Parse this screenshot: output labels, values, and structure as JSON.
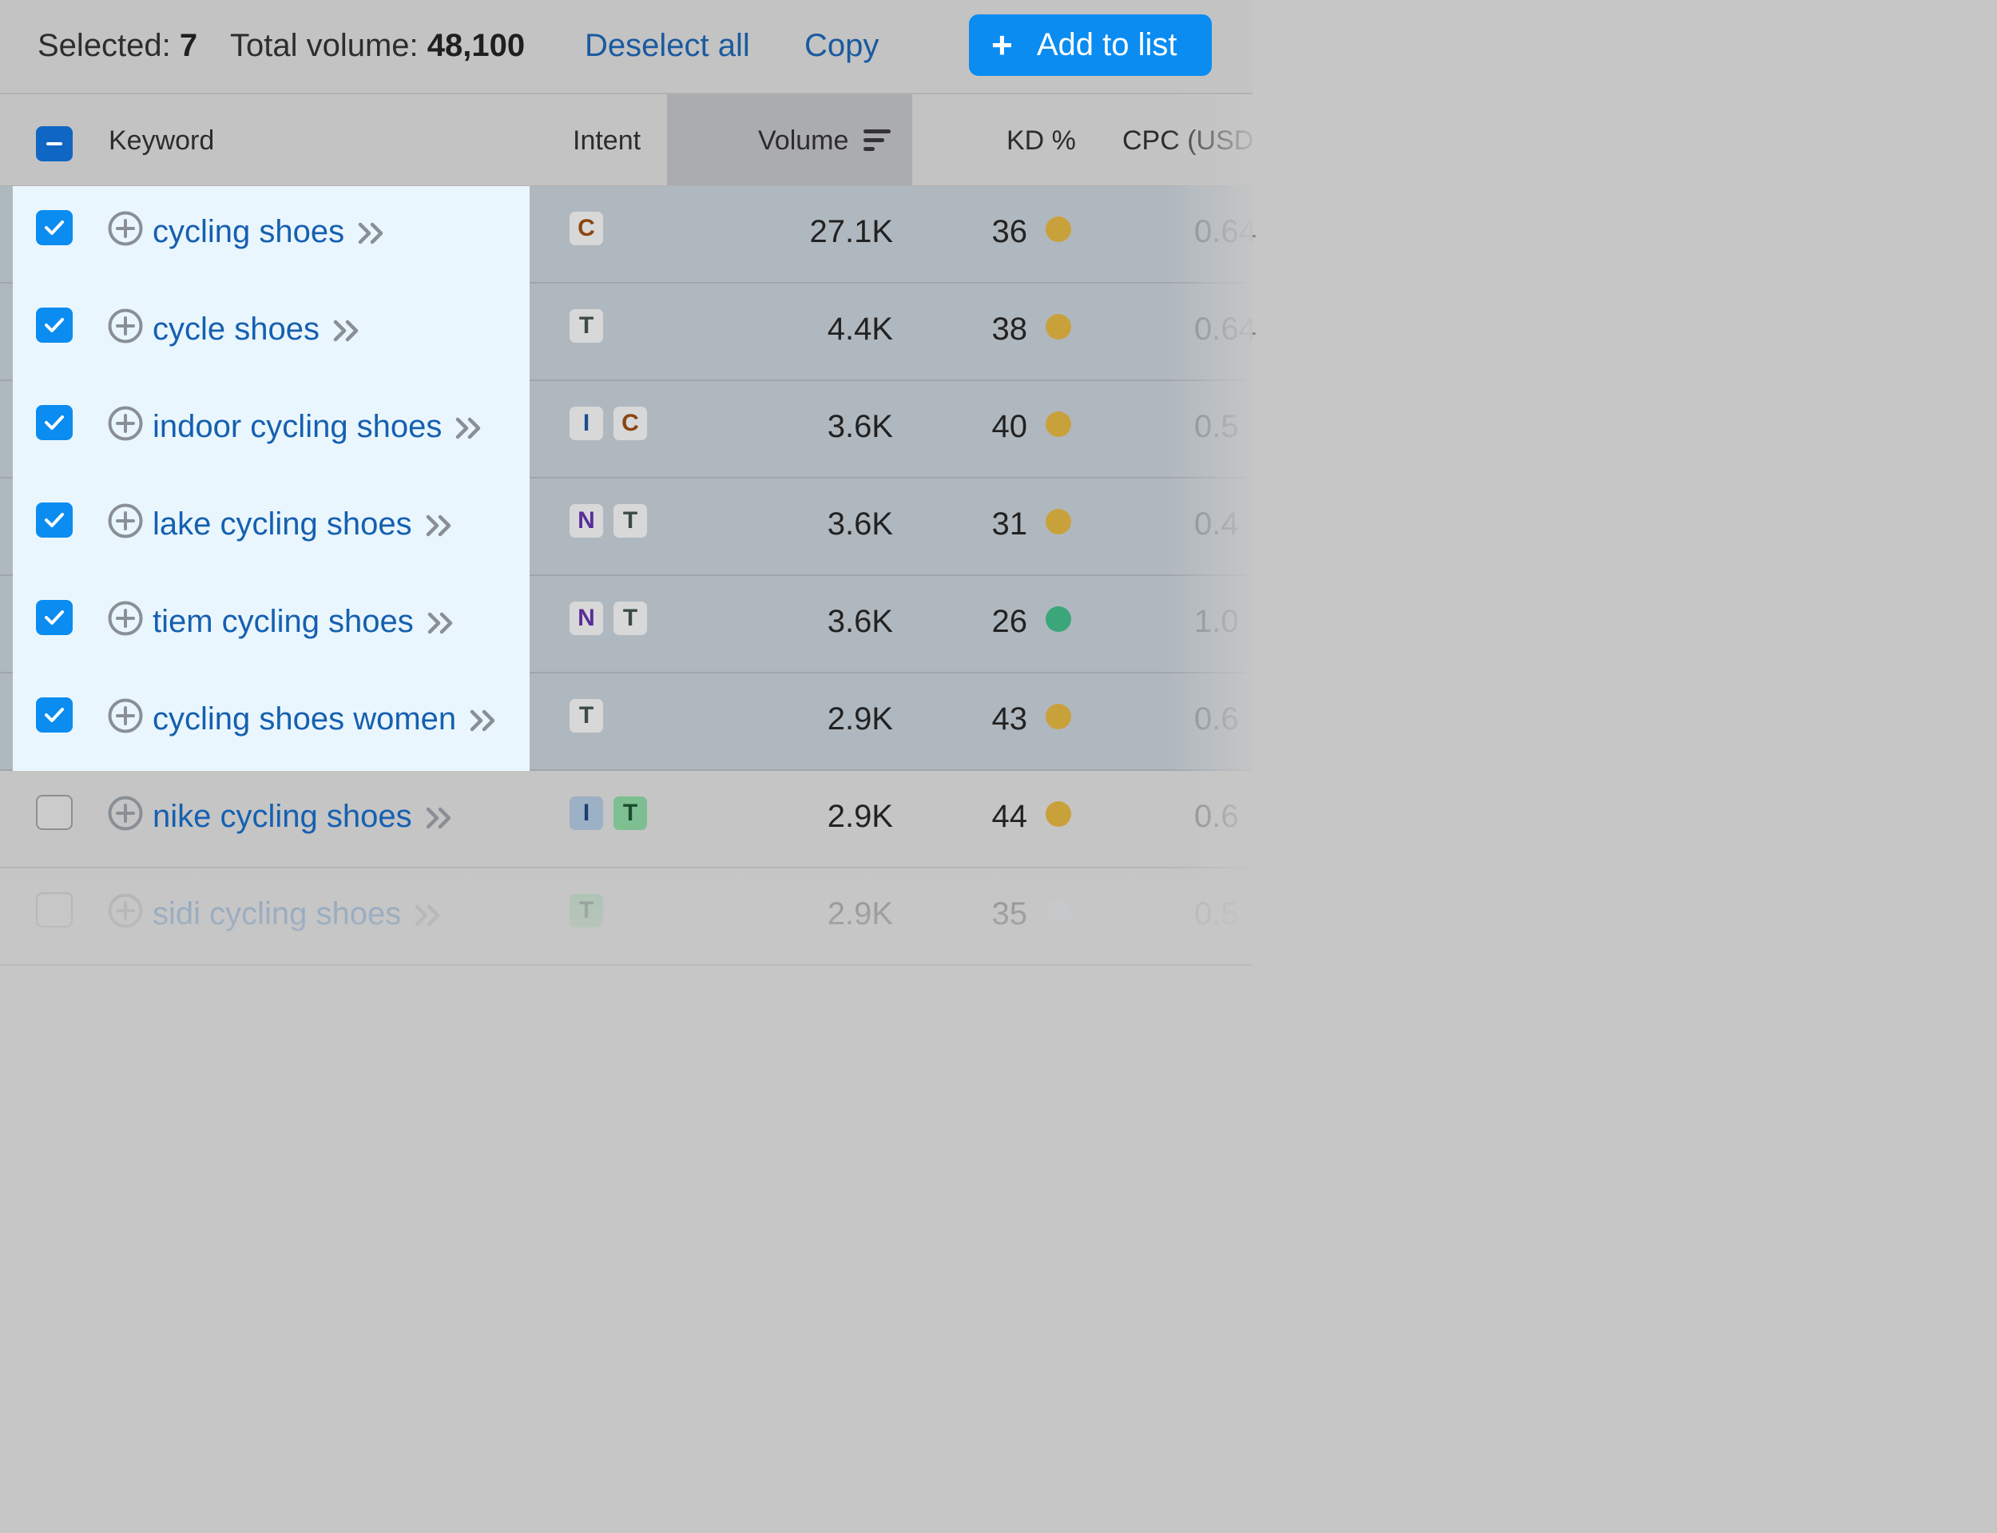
{
  "toolbar": {
    "selected_label": "Selected:",
    "selected_count": "7",
    "volume_label": "Total volume:",
    "volume_value": "48,100",
    "deselect_all": "Deselect all",
    "copy": "Copy",
    "add_to_list": "Add to list",
    "add_icon": "plus-icon"
  },
  "table": {
    "columns": {
      "keyword": "Keyword",
      "intent": "Intent",
      "volume": "Volume",
      "kd": "KD %",
      "cpc": "CPC (USD"
    },
    "rows": [
      {
        "keyword": "cycling shoes",
        "intents": [
          "C"
        ],
        "volume": "27.1K",
        "kd": "36",
        "kd_color": "#c9a13b",
        "cpc": "0.64",
        "checked": true
      },
      {
        "keyword": "cycle shoes",
        "intents": [
          "T"
        ],
        "volume": "4.4K",
        "kd": "38",
        "kd_color": "#c9a13b",
        "cpc": "0.64",
        "checked": true
      },
      {
        "keyword": "indoor cycling shoes",
        "intents": [
          "I",
          "C"
        ],
        "volume": "3.6K",
        "kd": "40",
        "kd_color": "#c9a13b",
        "cpc": "0.5",
        "checked": true
      },
      {
        "keyword": "lake cycling shoes",
        "intents": [
          "N",
          "T"
        ],
        "volume": "3.6K",
        "kd": "31",
        "kd_color": "#c9a13b",
        "cpc": "0.4",
        "checked": true
      },
      {
        "keyword": "tiem cycling shoes",
        "intents": [
          "N",
          "T"
        ],
        "volume": "3.6K",
        "kd": "26",
        "kd_color": "#3ba67a",
        "cpc": "1.0",
        "checked": true
      },
      {
        "keyword": "cycling shoes women",
        "intents": [
          "T"
        ],
        "volume": "2.9K",
        "kd": "43",
        "kd_color": "#c9a13b",
        "cpc": "0.6",
        "checked": true
      },
      {
        "keyword": "nike cycling shoes",
        "intents": [
          "I",
          "T"
        ],
        "volume": "2.9K",
        "kd": "44",
        "kd_color": "#c9a13b",
        "cpc": "0.6",
        "checked": false
      },
      {
        "keyword": "sidi cycling shoes",
        "intents": [
          "T"
        ],
        "volume": "2.9K",
        "kd": "35",
        "kd_color": "#c9cdd2",
        "cpc": "0.5",
        "checked": false
      }
    ]
  }
}
